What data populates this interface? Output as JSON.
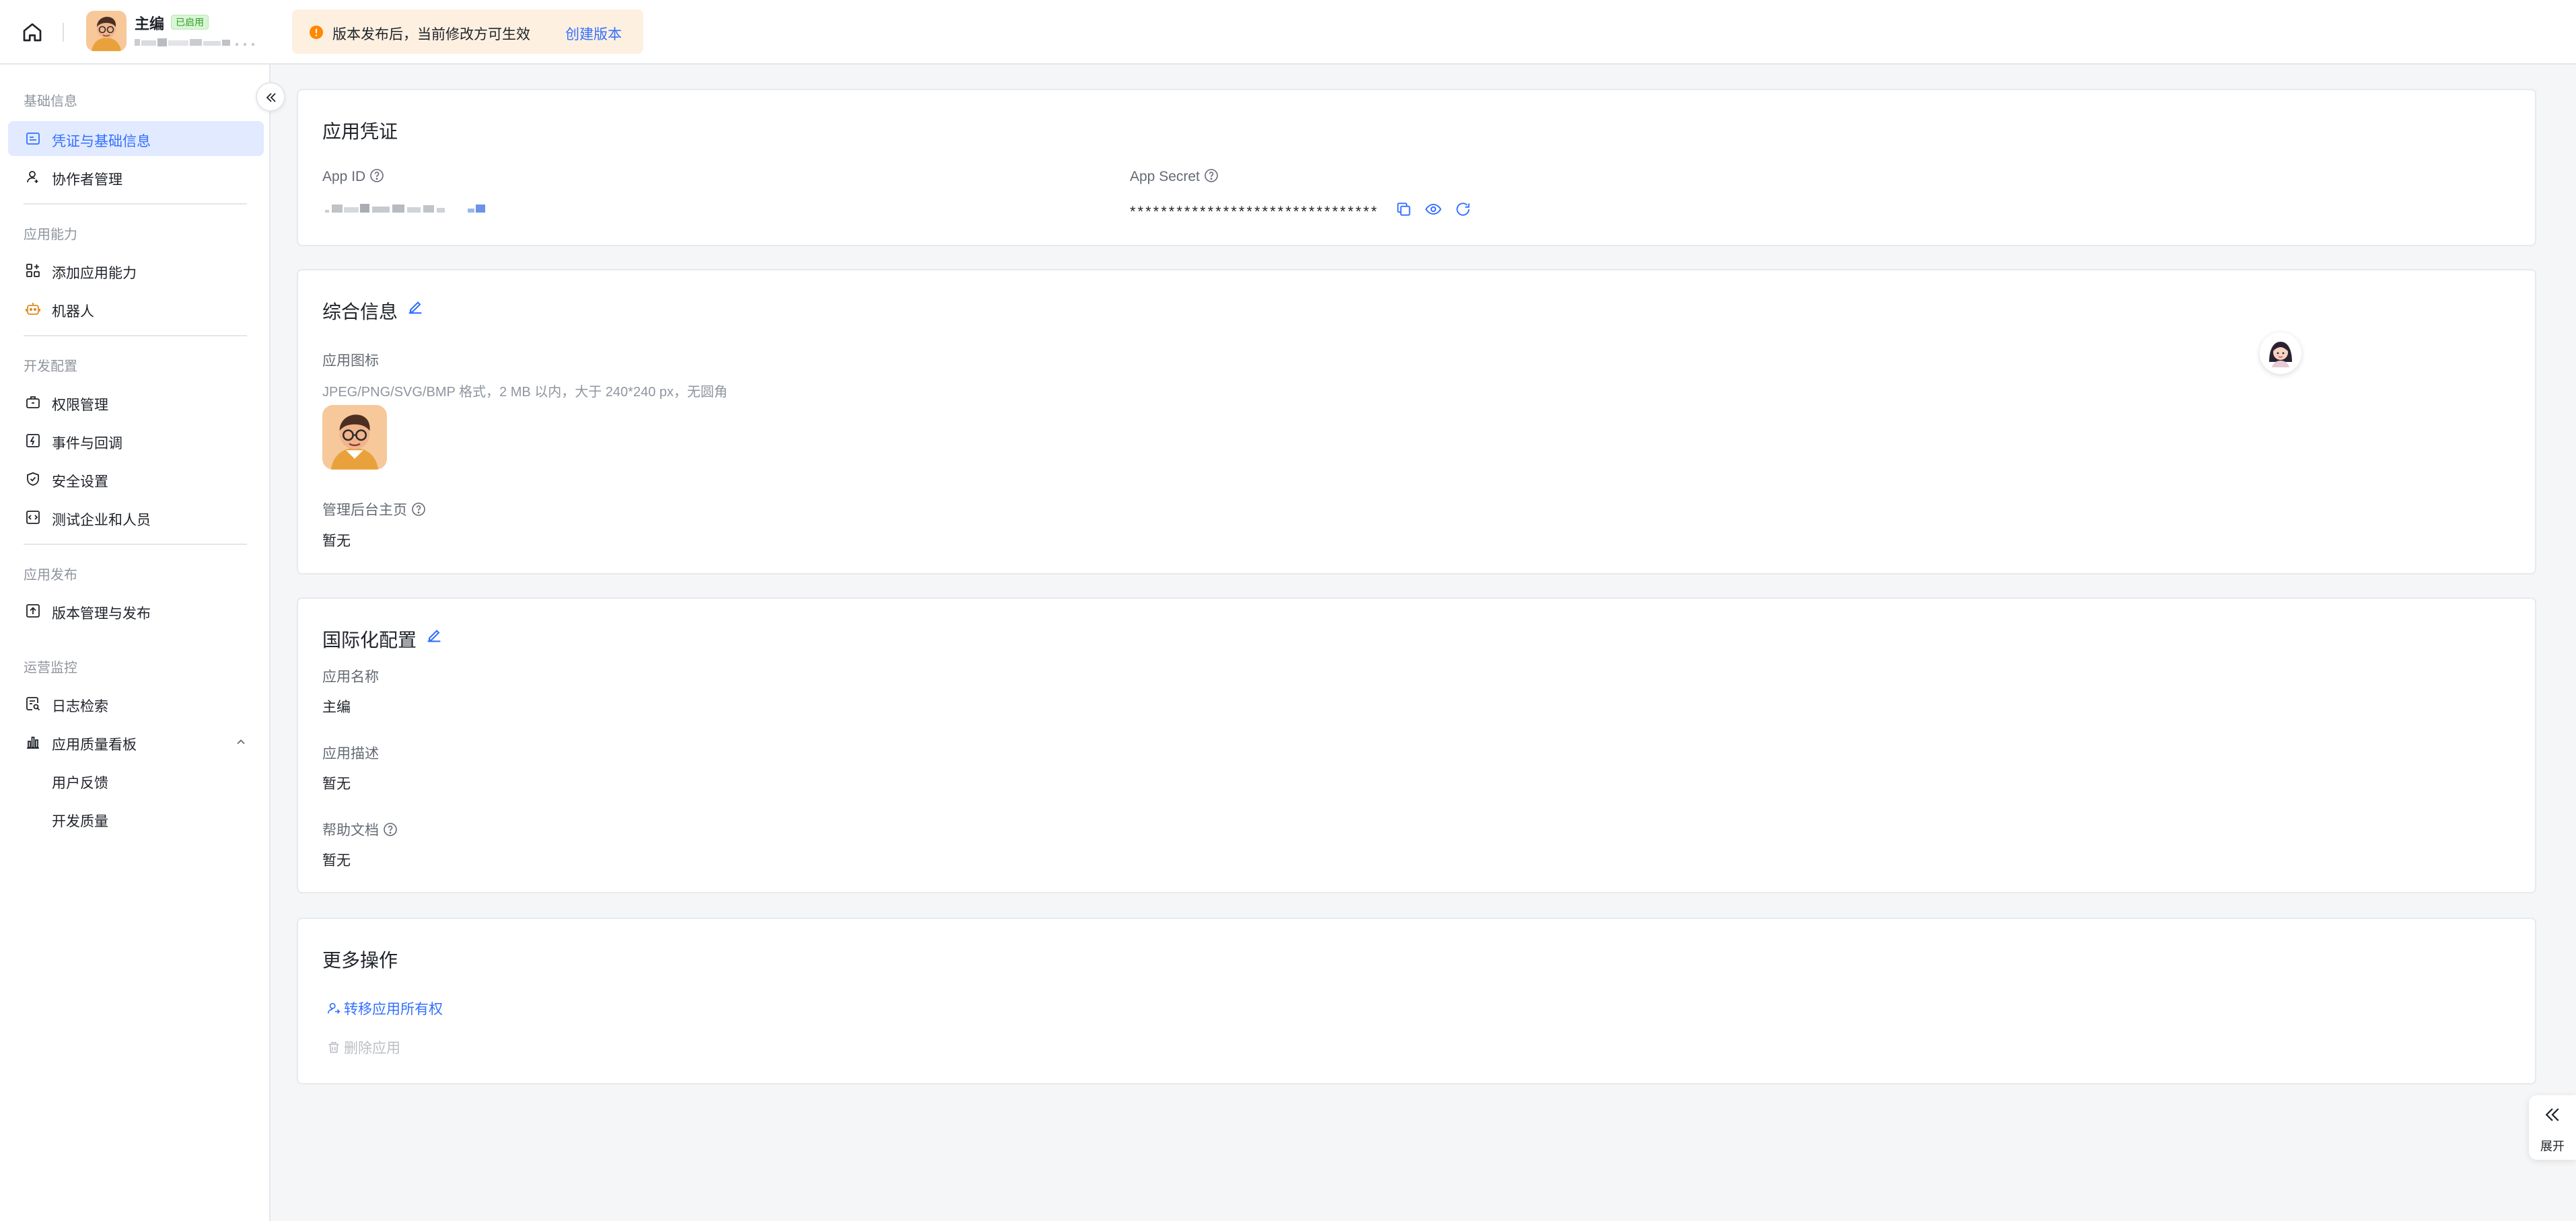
{
  "header": {
    "app_name": "主编",
    "status_badge": "已启用",
    "notice_text": "版本发布后，当前修改方可生效",
    "notice_link": "创建版本"
  },
  "sidebar": {
    "groups": [
      {
        "label": "基础信息",
        "items": [
          "凭证与基础信息",
          "协作者管理"
        ]
      },
      {
        "label": "应用能力",
        "items": [
          "添加应用能力",
          "机器人"
        ]
      },
      {
        "label": "开发配置",
        "items": [
          "权限管理",
          "事件与回调",
          "安全设置",
          "测试企业和人员"
        ]
      },
      {
        "label": "应用发布",
        "items": [
          "版本管理与发布"
        ]
      },
      {
        "label": "运营监控",
        "items": [
          "日志检索",
          "应用质量看板"
        ],
        "subitems": [
          "用户反馈",
          "开发质量"
        ]
      }
    ],
    "active_item": "凭证与基础信息"
  },
  "credentials": {
    "title": "应用凭证",
    "app_id_label": "App ID",
    "app_secret_label": "App Secret",
    "app_secret_value": "********************************"
  },
  "general": {
    "title": "综合信息",
    "icon_label": "应用图标",
    "icon_hint": "JPEG/PNG/SVG/BMP 格式，2 MB 以内，大于 240*240 px，无圆角",
    "homepage_label": "管理后台主页",
    "homepage_value": "暂无"
  },
  "i18n": {
    "title": "国际化配置",
    "name_label": "应用名称",
    "name_value": "主编",
    "desc_label": "应用描述",
    "desc_value": "暂无",
    "help_label": "帮助文档",
    "help_value": "暂无"
  },
  "more": {
    "title": "更多操作",
    "transfer": "转移应用所有权",
    "delete": "删除应用"
  },
  "expand_tab": {
    "label": "展开"
  },
  "colors": {
    "accent": "#3370ff",
    "active_bg": "#e1eaff",
    "notice_bg": "#fdf0e1",
    "warning": "#ff8800",
    "badge_green": "#2ea121"
  }
}
